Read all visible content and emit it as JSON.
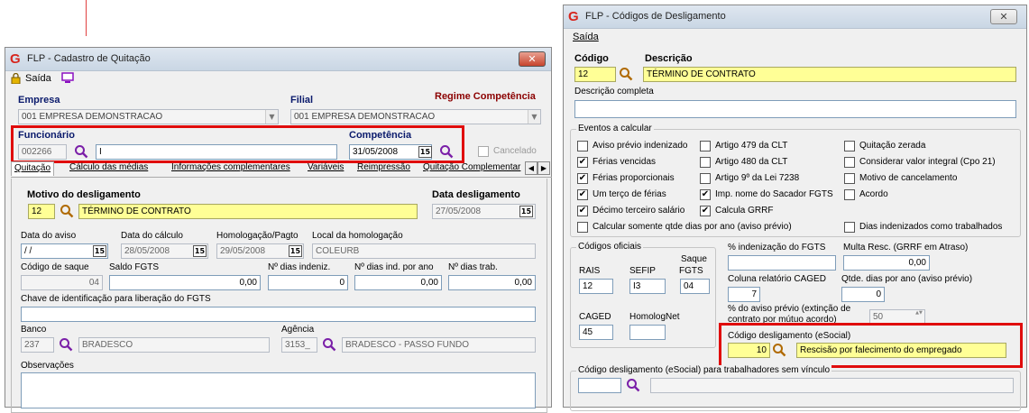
{
  "left_window": {
    "title": "FLP - Cadastro de Quitação",
    "close": "✕",
    "toolbar": {
      "exit_label": "Saída"
    },
    "empresa_label": "Empresa",
    "empresa_value": "001 EMPRESA DEMONSTRACAO",
    "filial_label": "Filial",
    "filial_value": "001 EMPRESA DEMONSTRACAO",
    "regime_label": "Regime Competência",
    "funcionario_label": "Funcionário",
    "funcionario_code": "002266",
    "funcionario_name": "I",
    "competencia_label": "Competência",
    "competencia_value": "31/05/2008",
    "cancelado_label": "Cancelado",
    "tabs": [
      "Quitação",
      "Cálculo das médias",
      "Informações complementares",
      "Variáveis",
      "Reimpressão",
      "Quitação Complementar"
    ],
    "motivo_label": "Motivo do desligamento",
    "motivo_code": "12",
    "motivo_desc": "TÉRMINO DE CONTRATO",
    "data_desligamento_label": "Data desligamento",
    "data_desligamento_value": "27/05/2008",
    "data_aviso_label": "Data do aviso",
    "data_aviso_value": " / /",
    "data_calculo_label": "Data do cálculo",
    "data_calculo_value": "28/05/2008",
    "homologacao_label": "Homologação/Pagto",
    "homologacao_value": "29/05/2008",
    "local_label": "Local da homologação",
    "local_value": "COLEURB",
    "codigo_saque_label": "Código de saque",
    "codigo_saque_value": "04",
    "saldo_fgts_label": "Saldo FGTS",
    "saldo_fgts_value": "0,00",
    "dias_indeniz_label": "Nº dias indeniz.",
    "dias_indeniz_value": "0",
    "dias_ind_ano_label": "Nº dias ind. por ano",
    "dias_ind_ano_value": "0,00",
    "dias_trab_label": "Nº dias trab.",
    "dias_trab_value": "0,00",
    "chave_label": "Chave de identificação para liberação do FGTS",
    "chave_value": "",
    "banco_label": "Banco",
    "banco_code": "237",
    "banco_name": "BRADESCO",
    "agencia_label": "Agência",
    "agencia_code": "3153_",
    "agencia_name": "BRADESCO - PASSO FUNDO",
    "obs_label": "Observações",
    "calendar_glyph": "15",
    "tab_scroll_left": "◀",
    "tab_scroll_right": "▶"
  },
  "right_window": {
    "title": "FLP - Códigos de Desligamento",
    "close": "✕",
    "menu_exit": "Saída",
    "codigo_label": "Código",
    "descricao_label": "Descrição",
    "codigo_value": "12",
    "descricao_value": "TÉRMINO DE CONTRATO",
    "desc_completa_label": "Descrição completa",
    "desc_completa_value": "",
    "eventos_title": "Eventos a calcular",
    "checks": [
      {
        "label": "Aviso prévio indenizado",
        "checked": false
      },
      {
        "label": "Artigo 479 da CLT",
        "checked": false
      },
      {
        "label": "Quitação zerada",
        "checked": false
      },
      {
        "label": "Férias vencidas",
        "checked": true
      },
      {
        "label": "Artigo 480 da CLT",
        "checked": false
      },
      {
        "label": "Considerar valor integral (Cpo 21)",
        "checked": false
      },
      {
        "label": "Férias proporcionais",
        "checked": true
      },
      {
        "label": "Artigo 9º da Lei 7238",
        "checked": false
      },
      {
        "label": "Motivo de cancelamento",
        "checked": false
      },
      {
        "label": "Um terço de férias",
        "checked": true
      },
      {
        "label": "Imp. nome do Sacador FGTS",
        "checked": true
      },
      {
        "label": "Acordo",
        "checked": false
      },
      {
        "label": "Décimo terceiro salário",
        "checked": true
      },
      {
        "label": "Calcula GRRF",
        "checked": true
      },
      {
        "label": "Calcular somente qtde dias por ano (aviso prévio)",
        "checked": false
      },
      {
        "label": "Dias indenizados como trabalhados",
        "checked": false
      }
    ],
    "codigos_oficiais_title": "Códigos oficiais",
    "rais_label": "RAIS",
    "rais_value": "12",
    "sefip_label": "SEFIP",
    "sefip_value": "I3",
    "saque_label_1": "Saque",
    "saque_label_2": "FGTS",
    "saque_value": "04",
    "caged_label": "CAGED",
    "caged_value": "45",
    "homolognet_label": "HomologNet",
    "homolognet_value": "",
    "pct_fgts_label": "% indenização do FGTS",
    "pct_fgts_value": "",
    "multa_label": "Multa Resc. (GRRF em Atraso)",
    "multa_value": "0,00",
    "coluna_caged_label": "Coluna relatório CAGED",
    "coluna_caged_value": "7",
    "qtde_dias_label": "Qtde. dias por ano (aviso prévio)",
    "qtde_dias_value": "0",
    "pct_aviso_label_1": "% do aviso prévio (extinção de",
    "pct_aviso_label_2": "contrato por mútuo acordo)",
    "pct_aviso_value": "50",
    "esocial_label": "Código desligamento (eSocial)",
    "esocial_code": "10",
    "esocial_desc": "Rescisão por falecimento do empregado",
    "esocial_sem_vinculo_label": "Código desligamento (eSocial) para trabalhadores sem vínculo",
    "esocial_sem_vinculo_code": "",
    "spin_glyph": "▲▼"
  },
  "colors": {
    "accent": "#e00c0c",
    "highlight": "#ffff96",
    "label_blue": "#0a1a6c",
    "regime": "#8b0000",
    "magnifier": "#7a1fa8"
  }
}
